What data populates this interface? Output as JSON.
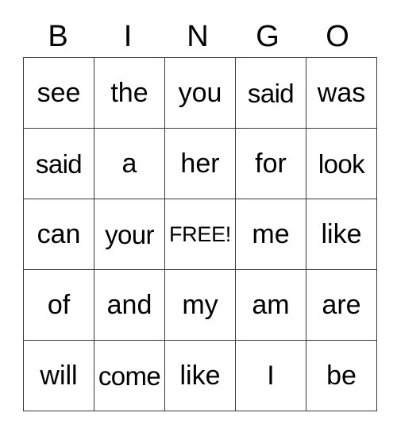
{
  "card": {
    "kind": "bingo-card",
    "title": "BINGO",
    "header_letters": [
      "B",
      "I",
      "N",
      "G",
      "O"
    ],
    "columns": 5,
    "rows": 5,
    "free_space": {
      "label": "FREE!",
      "row": 2,
      "column": 2
    },
    "colors": {
      "background": "#ffffff",
      "text": "#000000",
      "grid_line": "#3a3a3a"
    },
    "grid": [
      [
        {
          "text": "see",
          "size": "normal"
        },
        {
          "text": "the",
          "size": "normal"
        },
        {
          "text": "you",
          "size": "normal"
        },
        {
          "text": "said",
          "size": "tight"
        },
        {
          "text": "was",
          "size": "normal"
        }
      ],
      [
        {
          "text": "said",
          "size": "tight"
        },
        {
          "text": "a",
          "size": "normal"
        },
        {
          "text": "her",
          "size": "normal"
        },
        {
          "text": "for",
          "size": "normal"
        },
        {
          "text": "look",
          "size": "tight"
        }
      ],
      [
        {
          "text": "can",
          "size": "normal"
        },
        {
          "text": "your",
          "size": "tight"
        },
        {
          "text": "FREE!",
          "size": "free"
        },
        {
          "text": "me",
          "size": "normal"
        },
        {
          "text": "like",
          "size": "normal"
        }
      ],
      [
        {
          "text": "of",
          "size": "normal"
        },
        {
          "text": "and",
          "size": "normal"
        },
        {
          "text": "my",
          "size": "normal"
        },
        {
          "text": "am",
          "size": "normal"
        },
        {
          "text": "are",
          "size": "normal"
        }
      ],
      [
        {
          "text": "will",
          "size": "normal"
        },
        {
          "text": "come",
          "size": "tight"
        },
        {
          "text": "like",
          "size": "normal"
        },
        {
          "text": "I",
          "size": "normal"
        },
        {
          "text": "be",
          "size": "normal"
        }
      ]
    ]
  }
}
